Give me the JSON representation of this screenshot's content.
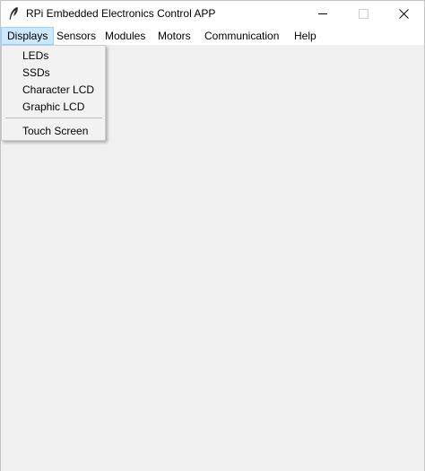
{
  "window": {
    "title": "RPi Embedded Electronics Control APP",
    "icon": "feather-icon"
  },
  "menubar": {
    "items": [
      {
        "label": "Displays",
        "active": true
      },
      {
        "label": "Sensors"
      },
      {
        "label": "Modules"
      },
      {
        "label": "Motors"
      },
      {
        "label": "Communication"
      },
      {
        "label": "Help"
      }
    ]
  },
  "dropdown": {
    "items": [
      "LEDs",
      "SSDs",
      "Character LCD",
      "Graphic LCD"
    ],
    "after_separator": [
      "Touch Screen"
    ]
  },
  "colors": {
    "menu_highlight": "#cce8ff",
    "menu_highlight_border": "#99d1ff",
    "client_background": "#f0f0f0"
  }
}
